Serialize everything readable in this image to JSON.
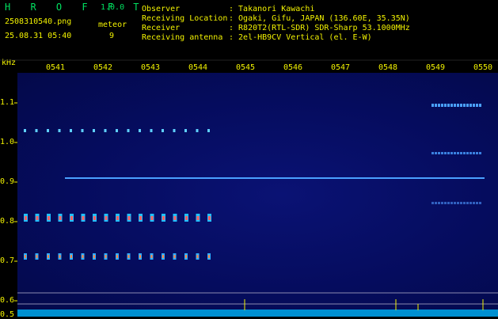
{
  "app": {
    "name": "H R O F F T",
    "version": "1.0.0"
  },
  "file": {
    "name": "2508310540.png",
    "timestamp": "25.08.31 05:40"
  },
  "meteor": {
    "label": "meteor",
    "count": "9"
  },
  "info": {
    "observer_label": "Observer",
    "observer_value": ": Takanori Kawachi",
    "location_label": "Receiving Location",
    "location_value": ": Ogaki, Gifu, JAPAN (136.60E, 35.35N)",
    "receiver_label": "Receiver",
    "receiver_value": ": R820T2(RTL-SDR) SDR-Sharp 53.1000MHz",
    "antenna_label": "Receiving antenna",
    "antenna_value": ": 2el-HB9CV Vertical (el. E-W)"
  },
  "axis": {
    "y_unit": "kHz",
    "x_ticks": [
      "0541",
      "0542",
      "0543",
      "0544",
      "0545",
      "0546",
      "0547",
      "0548",
      "0549",
      "0550"
    ],
    "y_ticks": [
      "1.1",
      "1.0",
      "0.9",
      "0.8",
      "0.7",
      "0.6",
      "0.5"
    ]
  },
  "colors": {
    "header_text": "#f2f200",
    "logo": "#00e060",
    "plot_bg": "#050c5e",
    "carrier": "#4aa0ff",
    "noise": "#00c8ff"
  }
}
